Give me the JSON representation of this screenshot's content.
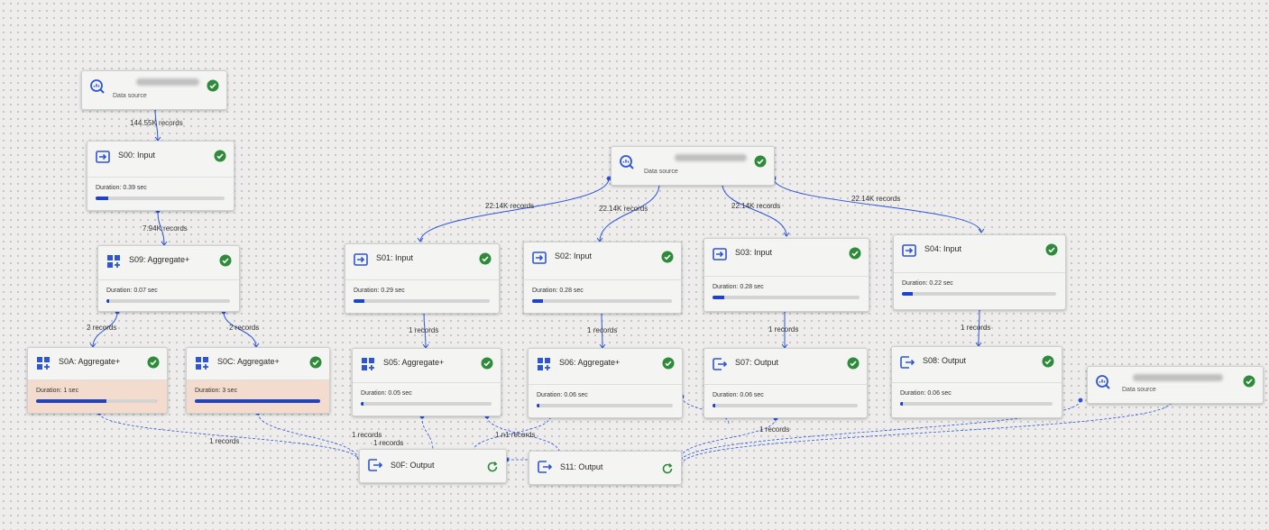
{
  "colors": {
    "accent": "#2c55d8",
    "ok": "#2e8b3a",
    "bar_fill": "#1f43c4",
    "warn_bg": "#f3dccd"
  },
  "nodes": {
    "ds1": {
      "title": "",
      "subtitle": "Data source",
      "icon": "data-source-icon",
      "status": "success"
    },
    "ds2": {
      "title": "",
      "subtitle": "Data source",
      "icon": "data-source-icon",
      "status": "success"
    },
    "ds3": {
      "title": "",
      "subtitle": "Data source",
      "icon": "data-source-icon",
      "status": "success"
    },
    "s00": {
      "title": "S00: Input",
      "duration": "Duration: 0.39 sec",
      "progress": 0.1,
      "icon": "input-icon",
      "status": "success"
    },
    "s09": {
      "title": "S09: Aggregate+",
      "duration": "Duration: 0.07 sec",
      "progress": 0.02,
      "icon": "aggregate-icon",
      "status": "success"
    },
    "s0a": {
      "title": "S0A: Aggregate+",
      "duration": "Duration: 1 sec",
      "progress": 0.58,
      "icon": "aggregate-icon",
      "status": "success"
    },
    "s0c": {
      "title": "S0C: Aggregate+",
      "duration": "Duration: 3 sec",
      "progress": 1.0,
      "icon": "aggregate-icon",
      "status": "success"
    },
    "s01": {
      "title": "S01: Input",
      "duration": "Duration: 0.29 sec",
      "progress": 0.08,
      "icon": "input-icon",
      "status": "success"
    },
    "s02": {
      "title": "S02: Input",
      "duration": "Duration: 0.28 sec",
      "progress": 0.08,
      "icon": "input-icon",
      "status": "success"
    },
    "s03": {
      "title": "S03: Input",
      "duration": "Duration: 0.28 sec",
      "progress": 0.08,
      "icon": "input-icon",
      "status": "success"
    },
    "s04": {
      "title": "S04: Input",
      "duration": "Duration: 0.22 sec",
      "progress": 0.07,
      "icon": "input-icon",
      "status": "success"
    },
    "s05": {
      "title": "S05: Aggregate+",
      "duration": "Duration: 0.05 sec",
      "progress": 0.02,
      "icon": "aggregate-icon",
      "status": "success"
    },
    "s06": {
      "title": "S06: Aggregate+",
      "duration": "Duration: 0.06 sec",
      "progress": 0.02,
      "icon": "aggregate-icon",
      "status": "success"
    },
    "s07": {
      "title": "S07: Output",
      "duration": "Duration: 0.06 sec",
      "progress": 0.02,
      "icon": "output-icon",
      "status": "success"
    },
    "s08": {
      "title": "S08: Output",
      "duration": "Duration: 0.06 sec",
      "progress": 0.02,
      "icon": "output-icon",
      "status": "success"
    },
    "s0f": {
      "title": "S0F: Output",
      "icon": "output-icon",
      "status": "running"
    },
    "s11": {
      "title": "S11: Output",
      "icon": "output-icon",
      "status": "running"
    }
  },
  "edges": {
    "ds1_s00": "144.55K records",
    "s00_s09": "7.94K records",
    "s09_s0a": "2 records",
    "s09_s0c": "2 records",
    "ds2_s01": "22.14K records",
    "ds2_s02": "22.14K records",
    "ds2_s03": "22.14K records",
    "ds2_s04": "22.14K records",
    "s01_s05": "1 records",
    "s02_s06": "1 records",
    "s03_s07": "1 records",
    "s04_s08": "1 records",
    "s0a_s0f": "1 records",
    "s0c_s0f": "1 records",
    "s05_s0f": "1 records",
    "s06_s11_a": "1 n1 records",
    "s07_s11": "1 records"
  }
}
